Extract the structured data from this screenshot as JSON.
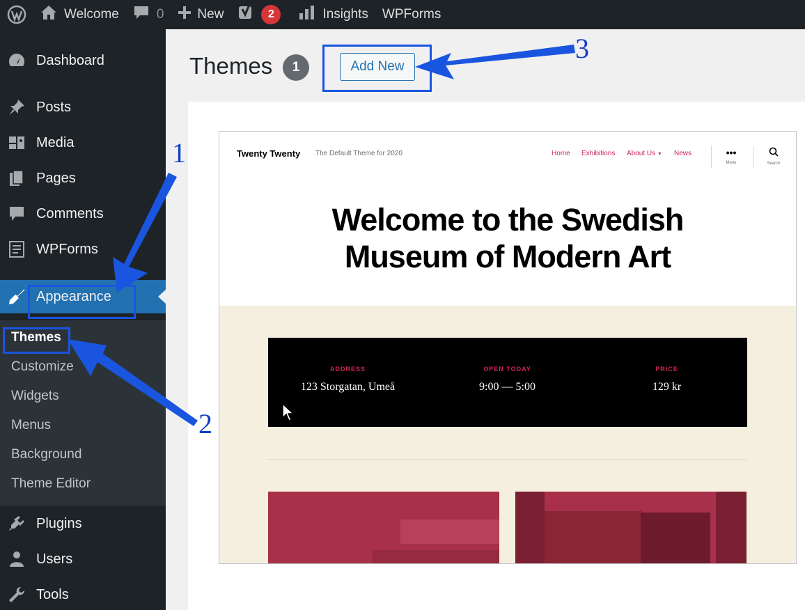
{
  "adminbar": {
    "site_name": "Welcome",
    "comments_count": "0",
    "new_label": "New",
    "yoast_badge": "2",
    "insights_label": "Insights",
    "wpforms_label": "WPForms"
  },
  "sidebar": {
    "dashboard": "Dashboard",
    "posts": "Posts",
    "media": "Media",
    "pages": "Pages",
    "comments": "Comments",
    "wpforms": "WPForms",
    "appearance": "Appearance",
    "submenu": {
      "themes": "Themes",
      "customize": "Customize",
      "widgets": "Widgets",
      "menus": "Menus",
      "background": "Background",
      "theme_editor": "Theme Editor"
    },
    "plugins": "Plugins",
    "users": "Users",
    "tools": "Tools"
  },
  "main": {
    "title": "Themes",
    "count": "1",
    "add_new": "Add New"
  },
  "theme_preview": {
    "site_title": "Twenty Twenty",
    "tagline": "The Default Theme for 2020",
    "nav": {
      "home": "Home",
      "exhibitions": "Exhibitions",
      "about": "About Us",
      "news": "News"
    },
    "menu_label": "Menu",
    "search_label": "Search",
    "hero_line1": "Welcome to the Swedish",
    "hero_line2": "Museum of Modern Art",
    "info": {
      "address_label": "ADDRESS",
      "address_value": "123 Storgatan, Umeå",
      "open_label": "OPEN TODAY",
      "open_value": "9:00 — 5:00",
      "price_label": "PRICE",
      "price_value": "129 kr"
    }
  },
  "annotations": {
    "step1": "1",
    "step2": "2",
    "step3": "3",
    "color": "#1a55e0"
  },
  "colors": {
    "admin_dark": "#1d2327",
    "accent_blue": "#2271b1",
    "badge_red": "#d63638",
    "theme_accent": "#cd2653"
  }
}
